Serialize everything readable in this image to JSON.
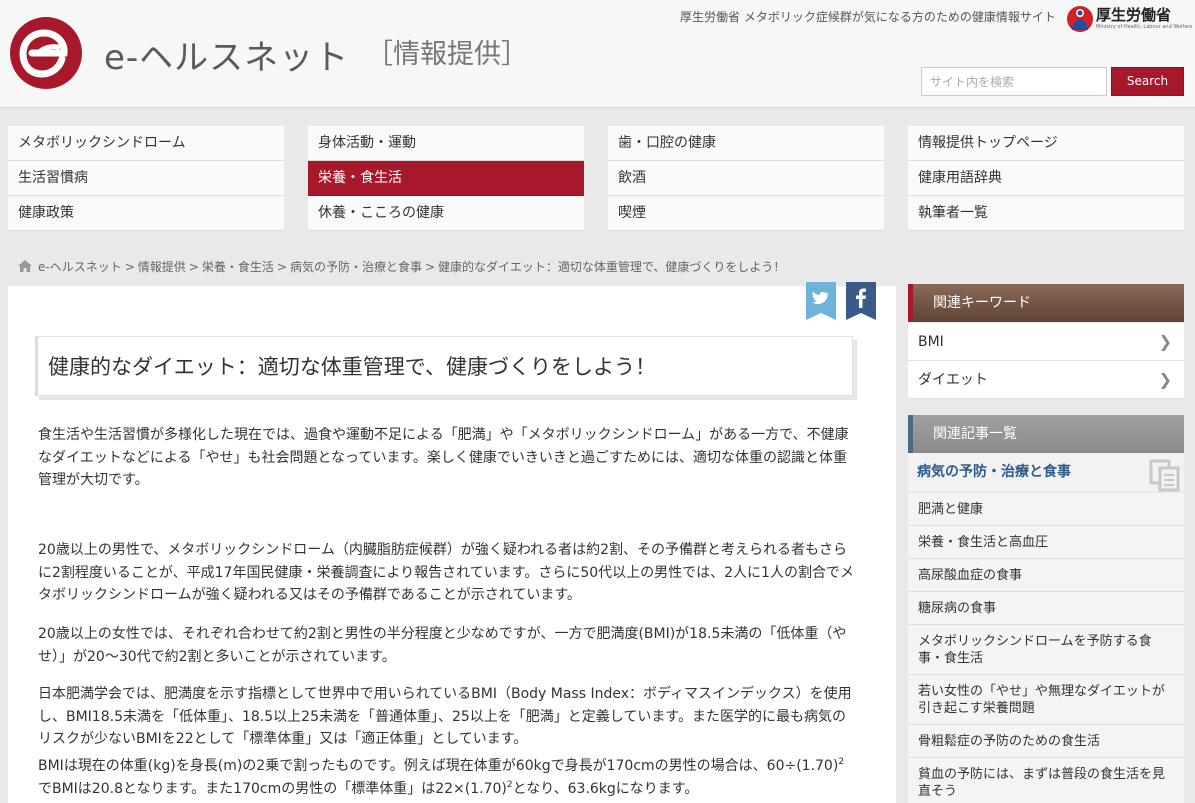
{
  "header": {
    "site_name": "e-ヘルスネット",
    "site_sub": "［情報提供］",
    "tagline": "厚生労働省 メタボリック症候群が気になる方のための健康情報サイト",
    "ministry_name": "厚生労働省",
    "ministry_en": "Ministry of Health, Labour and Welfare",
    "search_placeholder": "サイト内を検索",
    "search_label": "Search"
  },
  "nav": {
    "col1": [
      "メタボリックシンドローム",
      "生活習慣病",
      "健康政策"
    ],
    "col2": [
      "身体活動・運動",
      "栄養・食生活",
      "休養・こころの健康"
    ],
    "col3": [
      "歯・口腔の健康",
      "飲酒",
      "喫煙"
    ],
    "col4": [
      "情報提供トップページ",
      "健康用語辞典",
      "執筆者一覧"
    ],
    "active": "栄養・食生活"
  },
  "breadcrumb": [
    "e-ヘルスネット",
    "情報提供",
    "栄養・食生活",
    "病気の予防・治療と食事",
    "健康的なダイエット：適切な体重管理で、健康づくりをしよう！"
  ],
  "article": {
    "title": "健康的なダイエット：適切な体重管理で、健康づくりをしよう！",
    "p1": "食生活や生活習慣が多様化した現在では、過食や運動不足による「肥満」や「メタボリックシンドローム」がある一方で、不健康なダイエットなどによる「やせ」も社会問題となっています。楽しく健康でいきいきと過ごすためには、適切な体重の認識と体重管理が大切です。",
    "p2": "20歳以上の男性で、メタボリックシンドローム（内臓脂肪症候群）が強く疑われる者は約2割、その予備群と考えられる者もさらに2割程度いることが、平成17年国民健康・栄養調査により報告されています。さらに50代以上の男性では、2人に1人の割合でメタボリックシンドロームが強く疑われる又はその予備群であることが示されています。",
    "p3": "20歳以上の女性では、それぞれ合わせて約2割と男性の半分程度と少なめですが、一方で肥満度(BMI)が18.5未満の「低体重（やせ）」が20～30代で約2割と多いことが示されています。",
    "p4": "日本肥満学会では、肥満度を示す指標として世界中で用いられているBMI（Body Mass Index：ボディマスインデックス）を使用し、BMI18.5未満を「低体重」、18.5以上25未満を「普通体重」、25以上を「肥満」と定義しています。また医学的に最も病気のリスクが少ないBMIを22として「標準体重」又は「適正体重」としています。",
    "p5_a": "BMIは現在の体重(kg)を身長(m)の2乗で割ったものです。例えば現在体重が60kgで身長が170cmの男性の場合は、60÷(1.70)",
    "p5_sup1": "2",
    "p5_b": "でBMIは20.8となります。また170cmの男性の「標準体重」は22×(1.70)",
    "p5_sup2": "2",
    "p5_c": "となり、63.6kgになります。"
  },
  "sidebar": {
    "keywords_title": "関連キーワード",
    "keywords": [
      "BMI",
      "ダイエット"
    ],
    "related_title": "関連記事一覧",
    "related_category": "病気の予防・治療と食事",
    "related": [
      "肥満と健康",
      "栄養・食生活と高血圧",
      "高尿酸血症の食事",
      "糖尿病の食事",
      "メタボリックシンドロームを予防する食事・食生活",
      "若い女性の「やせ」や無理なダイエットが引き起こす栄養問題",
      "骨粗鬆症の予防のための食生活",
      "貧血の予防には、まずは普段の食生活を見直そう"
    ]
  },
  "colors": {
    "brand": "#a8182b",
    "link": "#2d5a8a",
    "twitter": "#6fb3d9",
    "facebook": "#3b5a8a"
  }
}
